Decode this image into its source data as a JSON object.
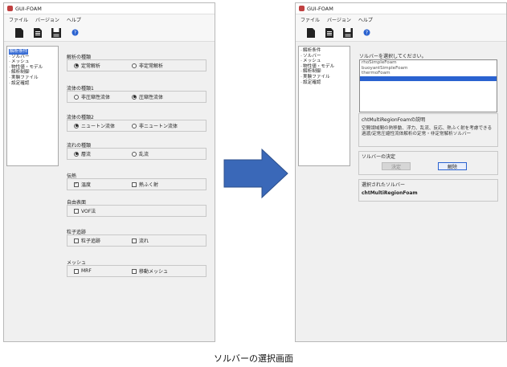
{
  "window": {
    "title": "GUI-FOAM",
    "menu": [
      "ファイル",
      "バージョン",
      "ヘルプ"
    ]
  },
  "tree": {
    "items": [
      "解析条件",
      "ソルバー",
      "メッシュ",
      "物性値・モデル",
      "解析制御",
      "実験ファイル",
      "設定確認"
    ]
  },
  "left": {
    "groups": [
      {
        "title": "解析の種類",
        "options": [
          {
            "kind": "radio",
            "label": "定常解析",
            "checked": true
          },
          {
            "kind": "radio",
            "label": "非定常解析",
            "checked": false
          }
        ]
      },
      {
        "title": "流体の種類1",
        "options": [
          {
            "kind": "radio",
            "label": "非圧縮性流体",
            "checked": false
          },
          {
            "kind": "radio",
            "label": "圧縮性流体",
            "checked": true
          }
        ]
      },
      {
        "title": "流体の種類2",
        "options": [
          {
            "kind": "radio",
            "label": "ニュートン流体",
            "checked": true
          },
          {
            "kind": "radio",
            "label": "非ニュートン流体",
            "checked": false
          }
        ]
      },
      {
        "title": "流れの種類",
        "options": [
          {
            "kind": "radio",
            "label": "層流",
            "checked": true
          },
          {
            "kind": "radio",
            "label": "乱流",
            "checked": false
          }
        ]
      },
      {
        "title": "伝熱",
        "options": [
          {
            "kind": "check",
            "label": "温度",
            "checked": true
          },
          {
            "kind": "check",
            "label": "熱ふく射",
            "checked": false
          }
        ]
      },
      {
        "title": "自由表面",
        "options": [
          {
            "kind": "check",
            "label": "VOF法",
            "checked": false
          }
        ]
      },
      {
        "title": "粒子追跡",
        "options": [
          {
            "kind": "check",
            "label": "粒子追跡",
            "checked": false
          },
          {
            "kind": "check",
            "label": "流れ",
            "checked": false
          }
        ]
      },
      {
        "title": "メッシュ",
        "options": [
          {
            "kind": "check",
            "label": "MRF",
            "checked": false
          },
          {
            "kind": "check",
            "label": "移動メッシュ",
            "checked": false
          }
        ]
      }
    ]
  },
  "right": {
    "select_label": "ソルバーを選択してください。",
    "solvers": [
      "rhoSimpleFoam",
      "buoyantSimpleFoam",
      "thermoFoam",
      ""
    ],
    "desc_title": "chtMultiRegionFoamの説明",
    "desc_text": "空間領域間の熱移動、浮力、乱流、反応、熱ふく射を考慮できる過渡/定常圧縮性流体解析の定常・非定常解析ソルバー",
    "decision_title": "ソルバーの決定",
    "decide_button": "決定",
    "cancel_button": "解除",
    "selected_title": "選択されたソルバー",
    "selected_value": "chtMultiRegionFoam"
  },
  "caption": "ソルバーの選択画面",
  "colors": {
    "selection": "#2a62d0",
    "arrow": "#3a68b8"
  }
}
